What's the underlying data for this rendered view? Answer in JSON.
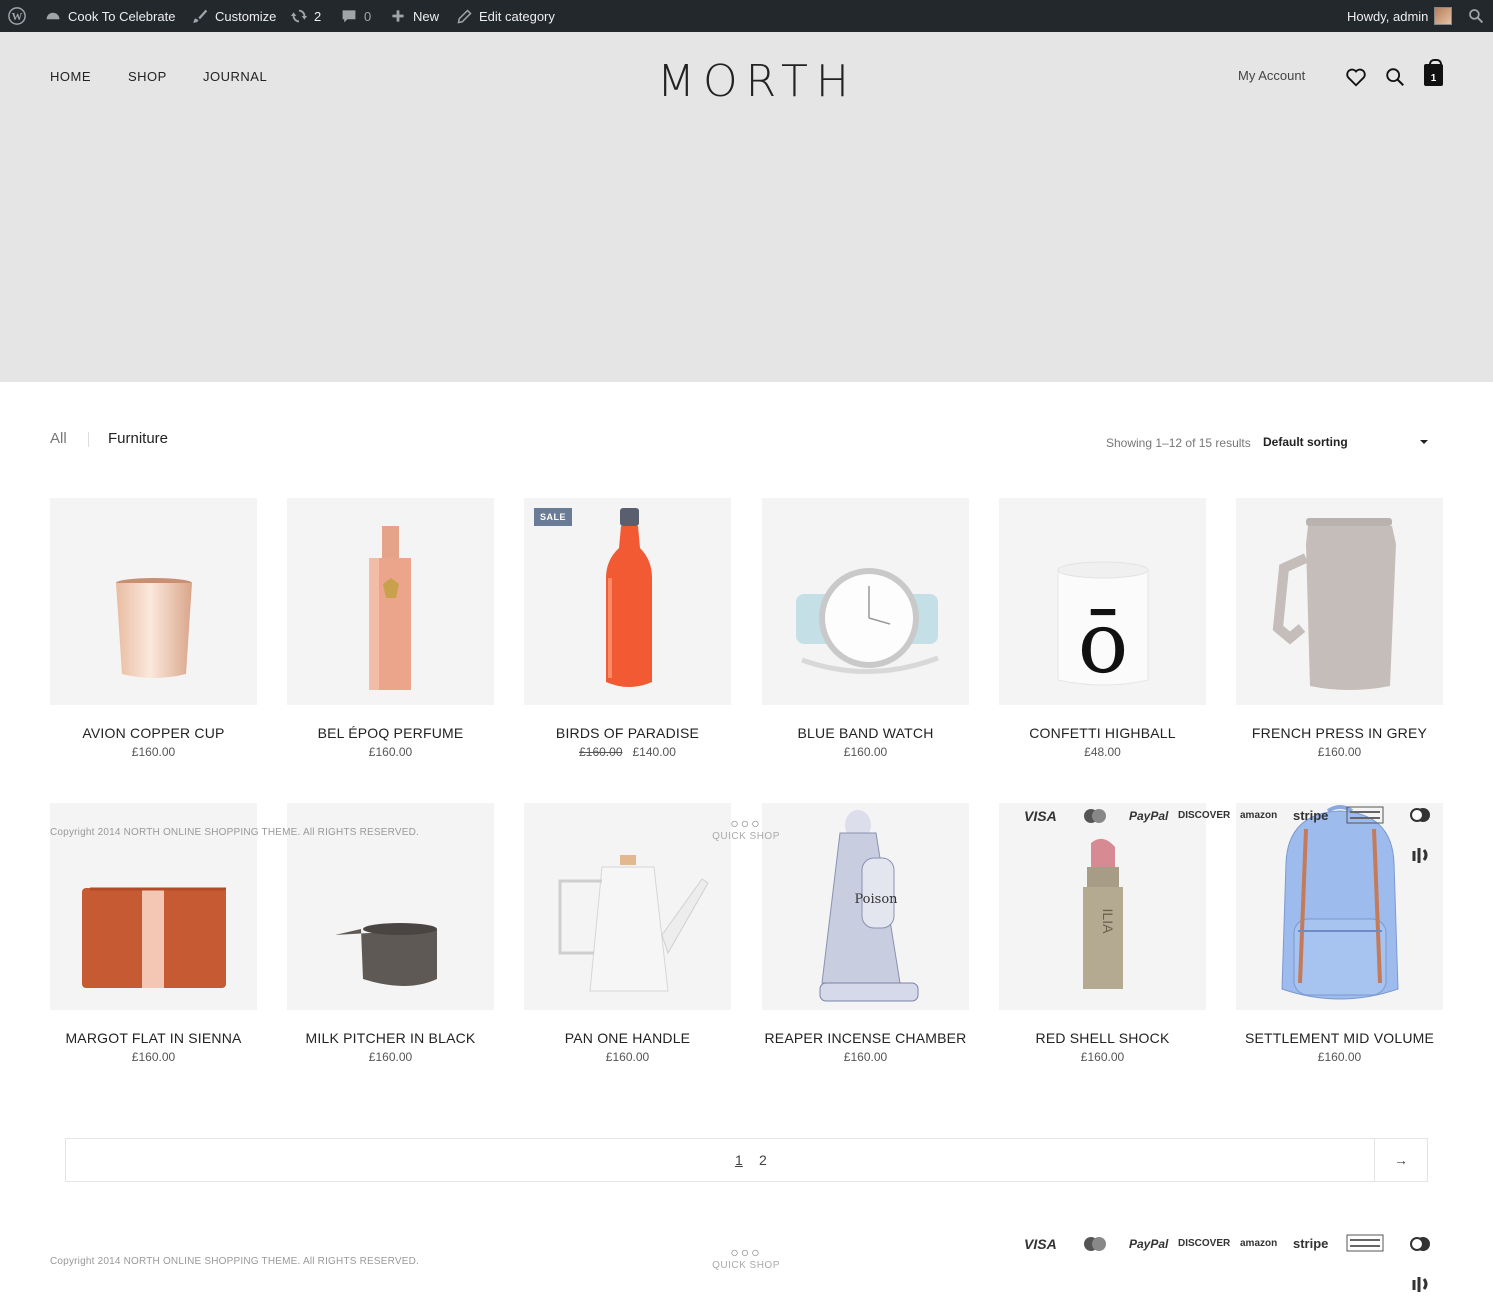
{
  "adminbar": {
    "site": "Cook To Celebrate",
    "customize": "Customize",
    "updates": "2",
    "comments": "0",
    "new": "New",
    "edit_category": "Edit category",
    "howdy": "Howdy, admin"
  },
  "header": {
    "nav": [
      "HOME",
      "SHOP",
      "JOURNAL"
    ],
    "logo": "MORTH",
    "my_account": "My Account",
    "cart_count": "1"
  },
  "filters": {
    "categories": [
      "All",
      "Furniture"
    ],
    "results": "Showing 1–12 of 15 results",
    "sorting": "Default sorting"
  },
  "products": [
    {
      "name": "AVION COPPER CUP",
      "price": "£160.00",
      "icon": "copper-cup"
    },
    {
      "name": "BEL ÉPOQ PERFUME",
      "price": "£160.00",
      "icon": "perfume-bottle"
    },
    {
      "name": "BIRDS OF PARADISE",
      "old_price": "£160.00",
      "price": "£140.00",
      "badge": "SALE",
      "icon": "water-bottle"
    },
    {
      "name": "BLUE BAND WATCH",
      "price": "£160.00",
      "icon": "watch"
    },
    {
      "name": "CONFETTI HIGHBALL",
      "price": "£48.00",
      "icon": "candle-glass",
      "glyph": "ō"
    },
    {
      "name": "FRENCH PRESS IN GREY",
      "price": "£160.00",
      "icon": "french-press"
    },
    {
      "name": "MARGOT FLAT IN SIENNA",
      "price": "£160.00",
      "icon": "clutch"
    },
    {
      "name": "MILK PITCHER IN BLACK",
      "price": "£160.00",
      "icon": "pitcher"
    },
    {
      "name": "PAN ONE HANDLE",
      "price": "£160.00",
      "icon": "kettle"
    },
    {
      "name": "REAPER INCENSE CHAMBER",
      "price": "£160.00",
      "icon": "reaper-figure",
      "glyph": "Poison"
    },
    {
      "name": "RED SHELL SHOCK",
      "price": "£160.00",
      "icon": "lipstick",
      "glyph": "ILIA"
    },
    {
      "name": "SETTLEMENT MID VOLUME",
      "price": "£160.00",
      "icon": "backpack"
    }
  ],
  "footer": {
    "copyright": "Copyright 2014 NORTH ONLINE SHOPPING THEME. All RIGHTS RESERVED.",
    "quick_shop": "QUICK SHOP",
    "payments": [
      "VISA",
      "PayPal",
      "DISCOVER",
      "amazon",
      "stripe"
    ]
  },
  "pagination": {
    "pages": [
      "1",
      "2"
    ],
    "next": "→"
  }
}
